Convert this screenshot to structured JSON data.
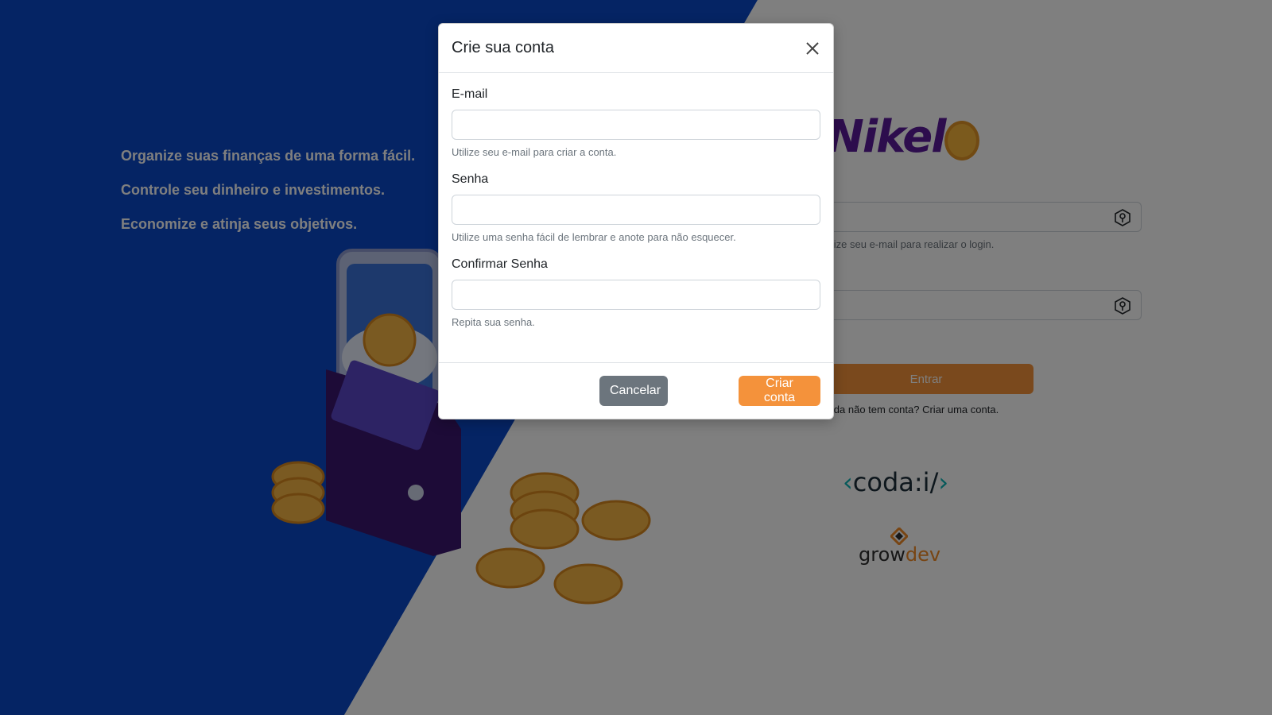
{
  "background": {
    "slogans": [
      "Organize suas finanças de uma forma fácil.",
      "Controle seu dinheiro e investimentos.",
      "Economize e atinja seus objetivos."
    ],
    "brand_logo": "Nikel",
    "login": {
      "email_help": "Utilize seu e-mail para realizar o login.",
      "submit_label": "Entrar",
      "signup_prefix": "Ainda não tem conta? ",
      "signup_link": "Criar uma conta."
    },
    "partner_logo_coda": "coda:i/",
    "partner_logo_growdev": {
      "part1": "grow",
      "part2": "dev"
    }
  },
  "modal": {
    "title": "Crie sua conta",
    "fields": {
      "email": {
        "label": "E-mail",
        "value": "",
        "help": "Utilize seu e-mail para criar a conta."
      },
      "password": {
        "label": "Senha",
        "value": "",
        "help": "Utilize uma senha fácil de lembrar e anote para não esquecer."
      },
      "confirm": {
        "label": "Confirmar Senha",
        "value": "",
        "help": "Repita sua senha."
      }
    },
    "buttons": {
      "cancel": "Cancelar",
      "create": "Criar conta"
    }
  },
  "colors": {
    "primary_blue": "#0a49c8",
    "accent_orange": "#f4923b",
    "secondary_gray": "#6c757d",
    "brand_purple": "#5b1b9a"
  }
}
